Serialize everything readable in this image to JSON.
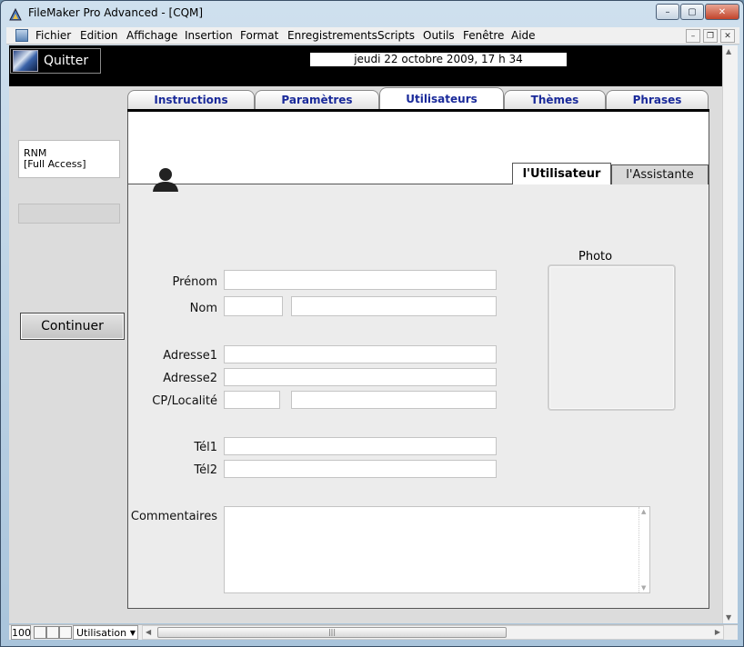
{
  "window": {
    "title": "FileMaker Pro Advanced - [CQM]",
    "minimize": "–",
    "maximize": "▢",
    "close": "✕"
  },
  "menu": {
    "items": [
      "Fichier",
      "Edition",
      "Affichage",
      "Insertion",
      "Format",
      "Enregistrements",
      "Scripts",
      "Outils",
      "Fenêtre",
      "Aide"
    ],
    "mdi_min": "–",
    "mdi_restore": "❐",
    "mdi_close": "✕"
  },
  "header": {
    "quit_label": "Quitter",
    "date": "jeudi 22 octobre 2009, 17 h 34"
  },
  "sidebar": {
    "user_name": "RNM",
    "user_access": "[Full Access]",
    "continue_label": "Continuer"
  },
  "tabs": [
    {
      "label": "Instructions",
      "active": false
    },
    {
      "label": "Paramètres",
      "active": false
    },
    {
      "label": "Utilisateurs",
      "active": true
    },
    {
      "label": "Thèmes",
      "active": false
    },
    {
      "label": "Phrases",
      "active": false
    }
  ],
  "subtabs": {
    "active": "l'Utilisateur",
    "inactive": "l'Assistante"
  },
  "form": {
    "prenom_label": "Prénom",
    "prenom_value": "",
    "nom_label": "Nom",
    "nom_prefix_value": "",
    "nom_value": "",
    "adresse1_label": "Adresse1",
    "adresse1_value": "",
    "adresse2_label": "Adresse2",
    "adresse2_value": "",
    "cp_label": "CP/Localité",
    "cp_value": "",
    "localite_value": "",
    "tel1_label": "Tél1",
    "tel1_value": "",
    "tel2_label": "Tél2",
    "tel2_value": "",
    "commentaires_label": "Commentaires",
    "commentaires_value": "",
    "photo_label": "Photo"
  },
  "statusbar": {
    "zoom": "100",
    "mode": "Utilisation"
  },
  "colors": {
    "tab_text": "#1a2a9a",
    "header_bg": "#000000"
  }
}
